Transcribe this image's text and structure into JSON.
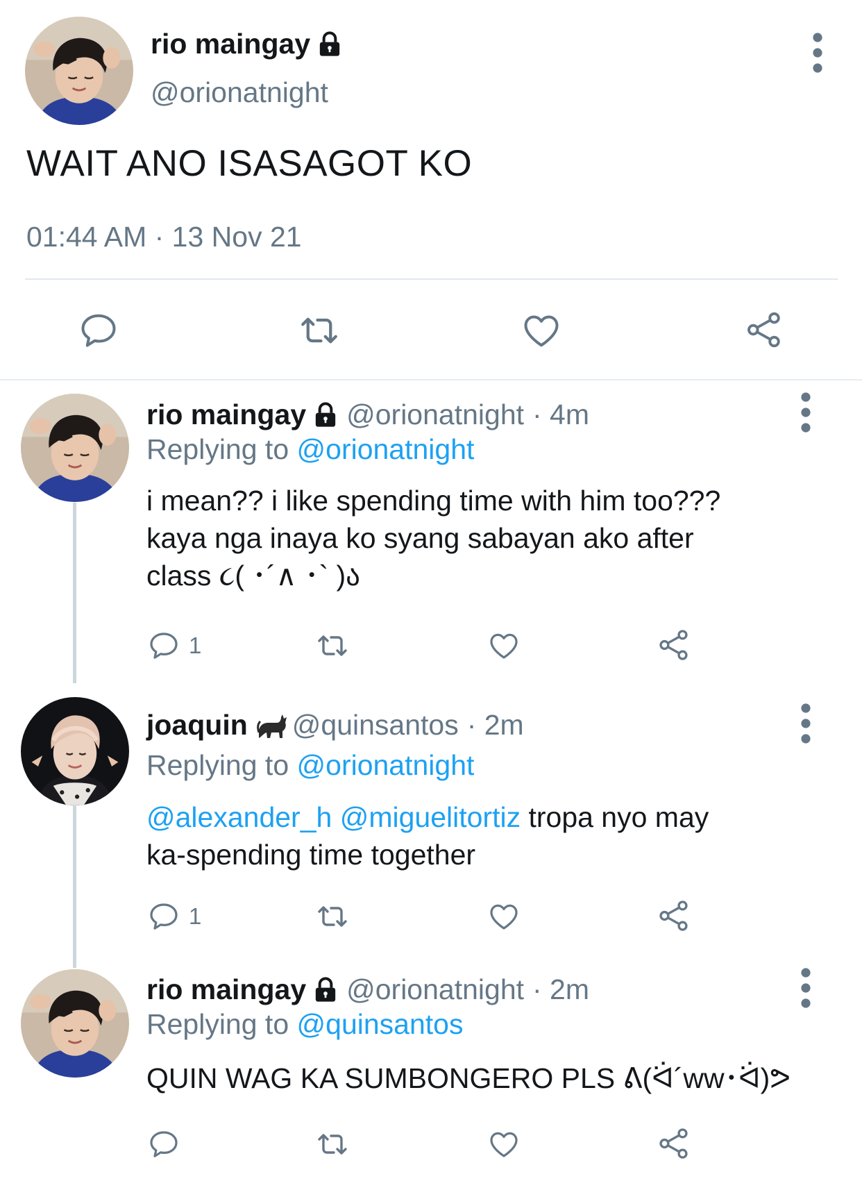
{
  "main_tweet": {
    "name": "rio maingay",
    "handle": "@orionatnight",
    "text": "WAIT ANO ISASAGOT KO",
    "timestamp": "01:44 AM · 13 Nov 21",
    "protected_icon": "lock-icon",
    "actions": [
      "reply-icon",
      "retweet-icon",
      "like-icon",
      "share-icon"
    ]
  },
  "replies": [
    {
      "name": "rio maingay",
      "handle": "@orionatnight",
      "time": "· 4m",
      "replying_prefix": "Replying to ",
      "replying_to": "@orionatnight",
      "text_lines": [
        "i mean?? i like spending time with him too???",
        "kaya nga inaya ko syang sabayan ako after",
        "class ૮( ･´∧ ･` )ა"
      ],
      "reply_count": "1"
    },
    {
      "name": "joaquin",
      "name_emoji": "cat-icon",
      "handle": "@quinsantos",
      "time": "· 2m",
      "replying_prefix": "Replying to ",
      "replying_to": "@orionatnight",
      "mention_1": "@alexander_h",
      "mention_2": "@miguelitortiz",
      "text_rest": " tropa nyo may",
      "text_line2": "ka-spending time together",
      "reply_count": "1"
    },
    {
      "name": "rio maingay",
      "handle": "@orionatnight",
      "time": "· 2m",
      "replying_prefix": "Replying to ",
      "replying_to": "@quinsantos",
      "text": "QUIN WAG KA SUMBONGERO PLS ᕕ(ᐛ´ww･ᐛ)ᕗ",
      "reply_count": ""
    }
  ],
  "colors": {
    "link": "#1da1f2",
    "secondary": "#657786",
    "primary_text": "#14171a",
    "divider": "#e6ecf0"
  }
}
